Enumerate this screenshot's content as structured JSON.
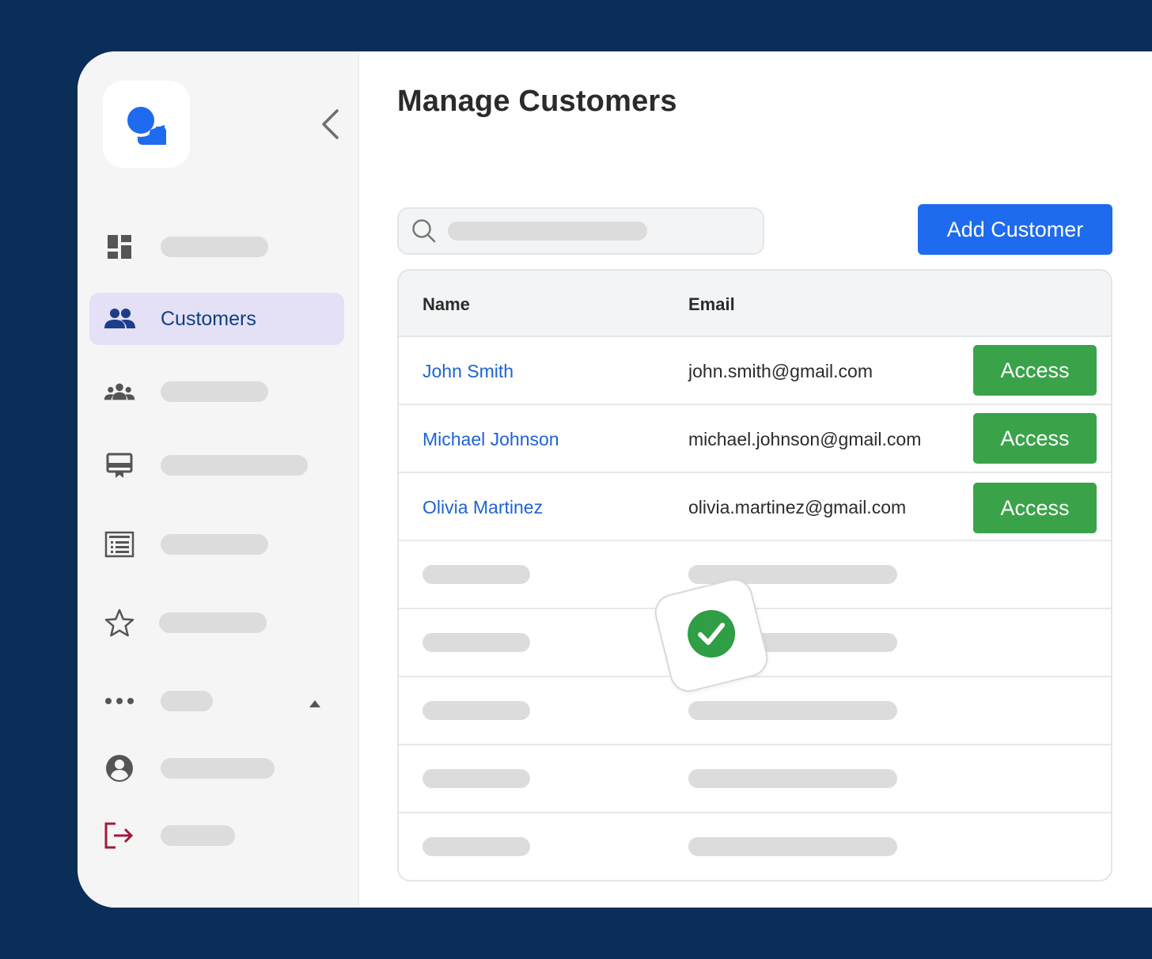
{
  "app": {
    "logo_icon": "chat-bubbles-logo-icon",
    "accent": "#1f6bf0"
  },
  "sidebar": {
    "collapse_icon": "chevron-left-icon",
    "items": [
      {
        "icon": "dashboard-icon",
        "label": ""
      },
      {
        "icon": "people-icon",
        "label": "Customers",
        "active": true
      },
      {
        "icon": "groups-icon",
        "label": ""
      },
      {
        "icon": "card-icon",
        "label": ""
      },
      {
        "icon": "list-icon",
        "label": ""
      },
      {
        "icon": "star-icon",
        "label": ""
      },
      {
        "icon": "more-icon",
        "label": "",
        "expand_icon": "caret-up-icon"
      },
      {
        "icon": "account-icon",
        "label": ""
      },
      {
        "icon": "logout-icon",
        "label": ""
      }
    ]
  },
  "main": {
    "title": "Manage Customers",
    "search": {
      "placeholder": "",
      "icon": "search-icon"
    },
    "add_button": "Add Customer"
  },
  "table": {
    "headers": [
      "Name",
      "Email"
    ],
    "rows": [
      {
        "name": "John Smith",
        "email": "john.smith@gmail.com",
        "action": "Access"
      },
      {
        "name": "Michael Johnson",
        "email": "michael.johnson@gmail.com",
        "action": "Access"
      },
      {
        "name": "Olivia Martinez",
        "email": "olivia.martinez@gmail.com",
        "action": "Access"
      }
    ],
    "action_color": "#3aa34a"
  },
  "overlay": {
    "icon": "check-circle-icon",
    "color": "#2f9e44"
  }
}
